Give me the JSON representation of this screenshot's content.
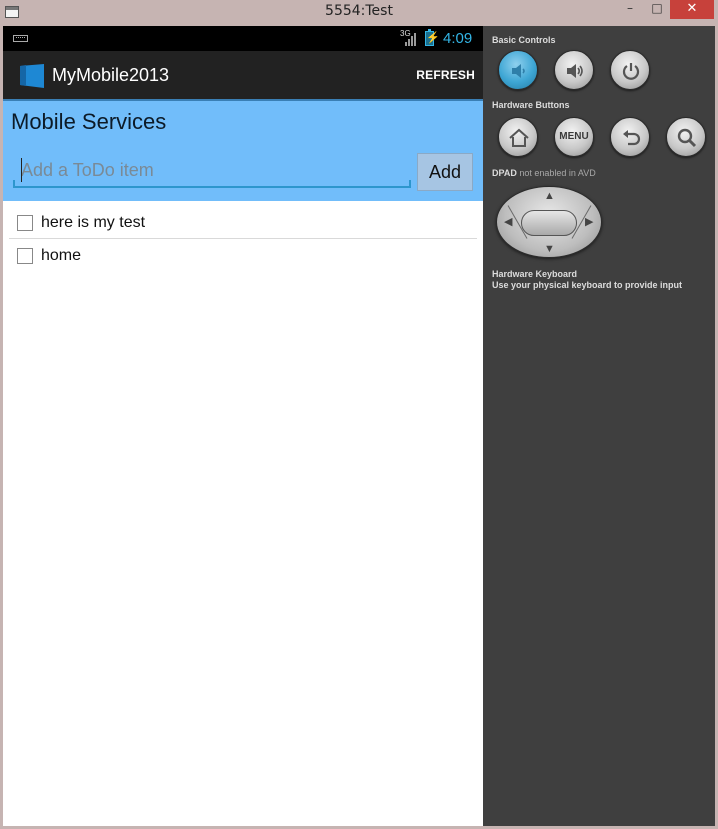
{
  "window": {
    "title": "5554:Test",
    "minimize_glyph": "–",
    "maximize_glyph": "□",
    "close_glyph": "✕"
  },
  "statusbar": {
    "network": "3G",
    "time": "4:09"
  },
  "actionbar": {
    "app_title": "MyMobile2013",
    "refresh_label": "REFRESH",
    "logo_color": "#1e88d4"
  },
  "header": {
    "title": "Mobile Services",
    "input_placeholder": "Add a ToDo item",
    "input_value": "",
    "add_label": "Add",
    "background": "#71bdfa"
  },
  "todo_items": [
    {
      "label": "here is my test",
      "checked": false
    },
    {
      "label": "home",
      "checked": false
    }
  ],
  "controls": {
    "basic_heading": "Basic Controls",
    "hardware_heading": "Hardware Buttons",
    "dpad_heading": "DPAD",
    "dpad_note": "not enabled in AVD",
    "menu_label": "MENU",
    "keyboard_heading": "Hardware Keyboard",
    "keyboard_note": "Use your physical keyboard to provide input",
    "active_color": "#3ea6d4",
    "buttons": [
      "volume-down-icon",
      "volume-up-icon",
      "power-icon",
      "home-icon",
      "menu-button",
      "back-icon",
      "search-icon"
    ]
  }
}
